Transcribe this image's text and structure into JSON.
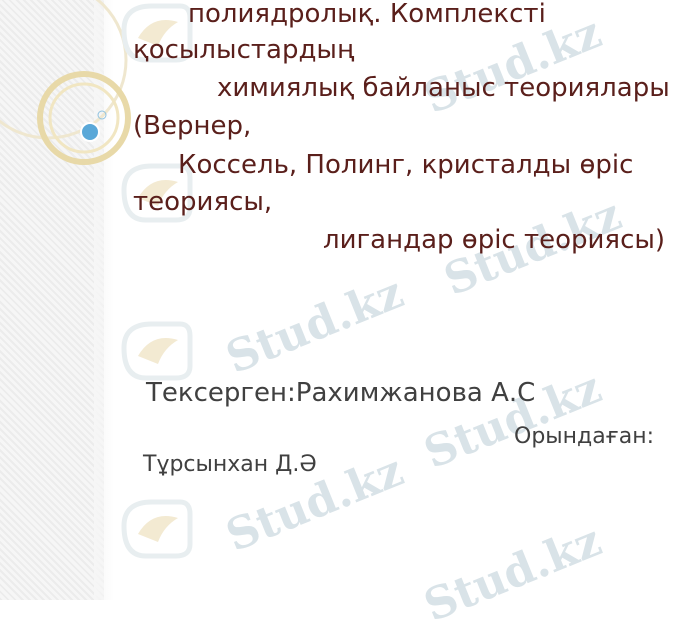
{
  "topic": {
    "line1": "полиядролық. Комплексті",
    "line2": "қосылыстардың",
    "line3": "химиялық байланыс теориялары",
    "line4": "(Вернер,",
    "line5": "Коссель, Полинг, кристалды өріс",
    "line6": "теориясы,",
    "line7": "лигандар өріс теориясы)"
  },
  "credits": {
    "checked_by": "Тексерген:Рахимжанова А.С",
    "performed_label": "Орындаған:",
    "performer": "Тұрсынхан Д.Ә"
  },
  "watermark": {
    "text": "Stud.kz"
  },
  "colors": {
    "title": "#5a1f1b",
    "credits": "#404040",
    "watermark": "#d9e3e8"
  }
}
